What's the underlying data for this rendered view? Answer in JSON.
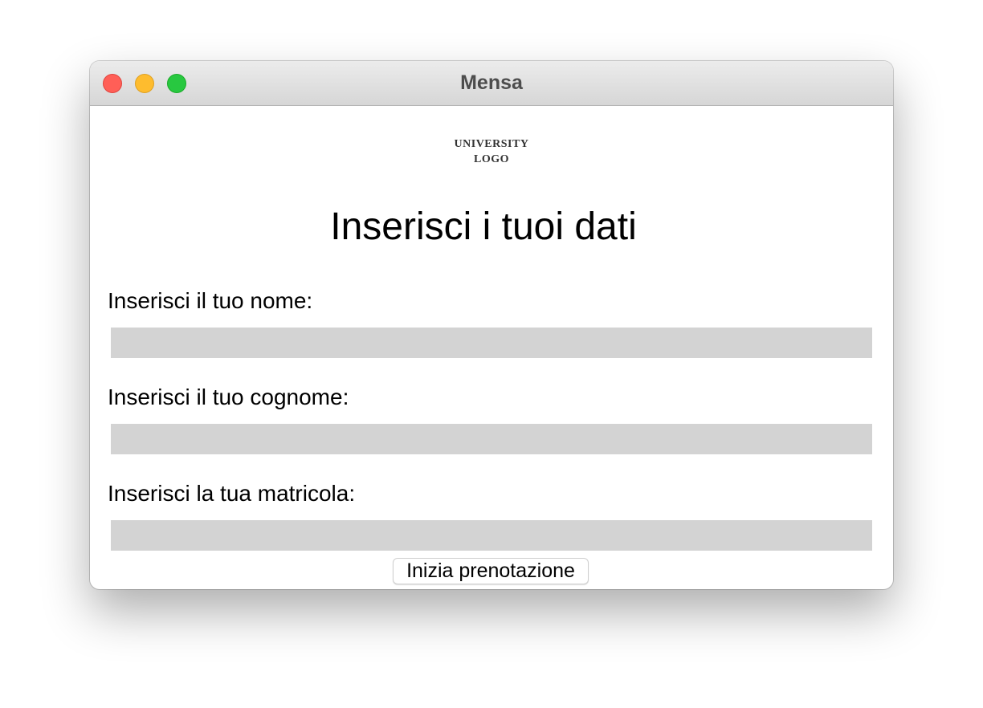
{
  "window": {
    "title": "Mensa"
  },
  "logo": {
    "line1": "UNIVERSITY",
    "line2": "LOGO"
  },
  "form": {
    "heading": "Inserisci i tuoi dati",
    "nome_label": "Inserisci il tuo nome:",
    "nome_value": "",
    "cognome_label": "Inserisci il tuo cognome:",
    "cognome_value": "",
    "matricola_label": "Inserisci la tua matricola:",
    "matricola_value": "",
    "submit_label": "Inizia prenotazione"
  },
  "colors": {
    "field_background": "#d3d3d3",
    "close": "#ff5f57",
    "minimize": "#febc2e",
    "zoom": "#28c840"
  }
}
